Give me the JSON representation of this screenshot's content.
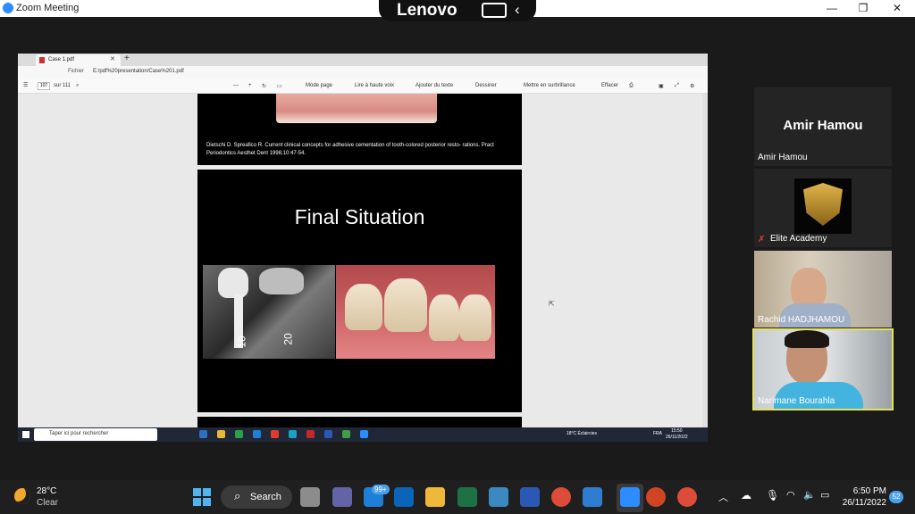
{
  "zoom": {
    "window_title": "Zoom Meeting",
    "min": "—",
    "max": "❐",
    "close": "✕"
  },
  "lenovo": {
    "brand": "Lenovo",
    "back": "‹"
  },
  "browser": {
    "tab_title": "Case 1.pdf",
    "new_tab": "+",
    "url_label": "Fichier",
    "url": "E:/pdf%20presentation/Case%201.pdf",
    "page_current": "107",
    "page_total": "sur 111",
    "tools": {
      "page_mode": "Mode page",
      "read_aloud": "Lire à haute voix",
      "add_text": "Ajouter du texte",
      "draw": "Dessiner",
      "highlight": "Mettre en surbrillance",
      "erase": "Effacer"
    }
  },
  "pdf": {
    "citation": "Dietschi D. Spreafico R. Current clinical concepts for adhesive cementation of tooth-colored posterior resto- rations. Pract Periodontics Aesthet Dent 1998,10:47-54.",
    "slide_title": "Final Situation",
    "xray_label_10": "10",
    "xray_label_20": "20"
  },
  "inner_taskbar": {
    "search_placeholder": "Taper ici pour rechercher",
    "weather": "18°C  Éclaircies",
    "lang": "FRA",
    "time": "15:50",
    "date": "26/11/2022"
  },
  "participants": [
    {
      "name": "Amir Hamou",
      "display": "Amir Hamou"
    },
    {
      "name": "Elite Academy"
    },
    {
      "name": "Rachid HADJHAMOU"
    },
    {
      "name": "Narimane Bourahla"
    }
  ],
  "taskbar": {
    "temp": "28°C",
    "condition": "Clear",
    "search_label": "Search",
    "mail_badge": "99+",
    "time": "6:50 PM",
    "date": "26/11/2022",
    "notifications": "52"
  },
  "colors": {
    "active_speaker_border": "#e6e05a",
    "zoom_blue": "#2d8cff"
  }
}
